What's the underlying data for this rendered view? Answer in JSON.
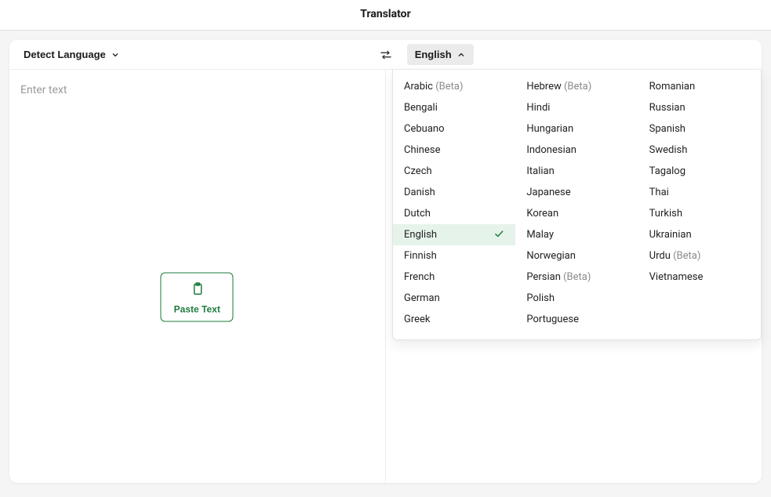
{
  "header": {
    "title": "Translator"
  },
  "source": {
    "label": "Detect Language",
    "placeholder": "Enter text",
    "paste_label": "Paste Text"
  },
  "target": {
    "label": "English",
    "selected": "English"
  },
  "beta_suffix": "(Beta)",
  "languages": {
    "col1": [
      {
        "name": "Arabic",
        "beta": true
      },
      {
        "name": "Bengali"
      },
      {
        "name": "Cebuano"
      },
      {
        "name": "Chinese"
      },
      {
        "name": "Czech"
      },
      {
        "name": "Danish"
      },
      {
        "name": "Dutch"
      },
      {
        "name": "English",
        "selected": true
      },
      {
        "name": "Finnish"
      },
      {
        "name": "French"
      },
      {
        "name": "German"
      },
      {
        "name": "Greek"
      }
    ],
    "col2": [
      {
        "name": "Hebrew",
        "beta": true
      },
      {
        "name": "Hindi"
      },
      {
        "name": "Hungarian"
      },
      {
        "name": "Indonesian"
      },
      {
        "name": "Italian"
      },
      {
        "name": "Japanese"
      },
      {
        "name": "Korean"
      },
      {
        "name": "Malay"
      },
      {
        "name": "Norwegian"
      },
      {
        "name": "Persian",
        "beta": true
      },
      {
        "name": "Polish"
      },
      {
        "name": "Portuguese"
      }
    ],
    "col3": [
      {
        "name": "Romanian"
      },
      {
        "name": "Russian"
      },
      {
        "name": "Spanish"
      },
      {
        "name": "Swedish"
      },
      {
        "name": "Tagalog"
      },
      {
        "name": "Thai"
      },
      {
        "name": "Turkish"
      },
      {
        "name": "Ukrainian"
      },
      {
        "name": "Urdu",
        "beta": true
      },
      {
        "name": "Vietnamese"
      }
    ]
  }
}
